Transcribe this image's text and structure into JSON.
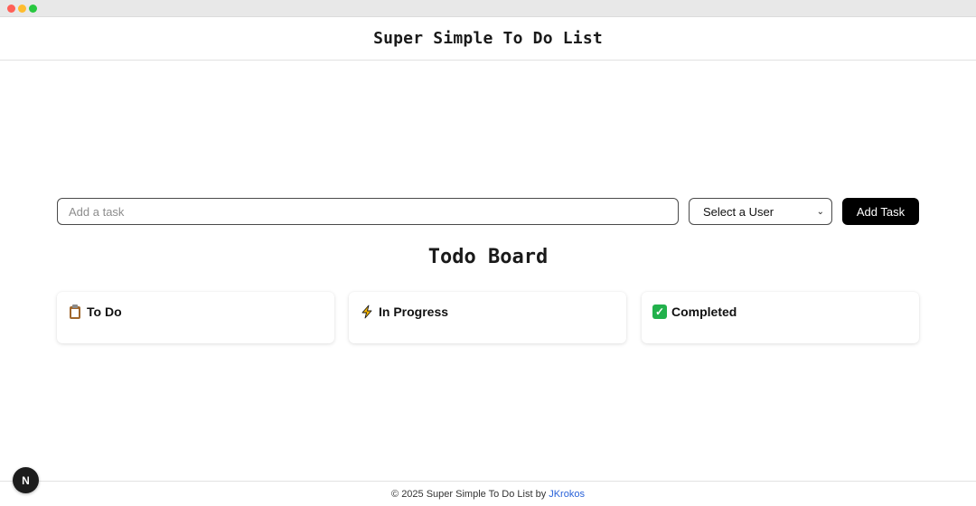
{
  "header": {
    "title": "Super Simple To Do List"
  },
  "form": {
    "task_placeholder": "Add a task",
    "task_value": "",
    "user_select": {
      "selected": "Select a User"
    },
    "add_button_label": "Add Task"
  },
  "board": {
    "title": "Todo Board",
    "columns": [
      {
        "title": "To Do",
        "icon": "clipboard-icon"
      },
      {
        "title": "In Progress",
        "icon": "lightning-icon"
      },
      {
        "title": "Completed",
        "icon": "check-mark-icon"
      }
    ]
  },
  "footer": {
    "text": "© 2025 Super Simple To Do List by",
    "link_text": "JKrokos"
  },
  "dev_badge": {
    "label": "N"
  },
  "colors": {
    "accent_button": "#000000",
    "link": "#2962d9",
    "completed_icon": "#22b14c",
    "progress_icon": "#f5b400"
  }
}
